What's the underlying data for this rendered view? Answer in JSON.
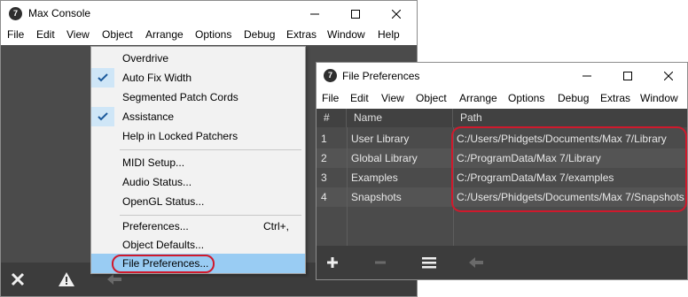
{
  "console": {
    "title": "Max Console",
    "icon_glyph": "7",
    "menu": [
      "File",
      "Edit",
      "View",
      "Object",
      "Arrange",
      "Options",
      "Debug",
      "Extras",
      "Window",
      "Help"
    ],
    "footer_icons": [
      "close-icon",
      "warning-icon",
      "back-arrow-icon"
    ]
  },
  "options_menu": {
    "items": [
      {
        "label": "Overdrive",
        "checked": false
      },
      {
        "label": "Auto Fix Width",
        "checked": true
      },
      {
        "label": "Segmented Patch Cords",
        "checked": false
      },
      {
        "label": "Assistance",
        "checked": true
      },
      {
        "label": "Help in Locked Patchers",
        "checked": false
      },
      {
        "label": "MIDI Setup...",
        "checked": false
      },
      {
        "label": "Audio Status...",
        "checked": false
      },
      {
        "label": "OpenGL Status...",
        "checked": false
      },
      {
        "label": "Preferences...",
        "shortcut": "Ctrl+,",
        "checked": false
      },
      {
        "label": "Object Defaults...",
        "checked": false
      },
      {
        "label": "File Preferences...",
        "checked": false,
        "selected": true
      }
    ]
  },
  "file_prefs": {
    "title": "File Preferences",
    "icon_glyph": "7",
    "menu": [
      "File",
      "Edit",
      "View",
      "Object",
      "Arrange",
      "Options",
      "Debug",
      "Extras",
      "Window"
    ],
    "columns": [
      "#",
      "Name",
      "Path"
    ],
    "rows": [
      {
        "num": "1",
        "name": "User Library",
        "path": "C:/Users/Phidgets/Documents/Max 7/Library"
      },
      {
        "num": "2",
        "name": "Global Library",
        "path": "C:/ProgramData/Max 7/Library"
      },
      {
        "num": "3",
        "name": "Examples",
        "path": "C:/ProgramData/Max 7/examples"
      },
      {
        "num": "4",
        "name": "Snapshots",
        "path": "C:/Users/Phidgets/Documents/Max 7/Snapshots"
      }
    ],
    "footer_icons": [
      "add-icon",
      "remove-icon",
      "list-icon",
      "back-arrow-icon"
    ]
  },
  "colors": {
    "highlight_circle": "#d0192c",
    "menu_selected": "#99ccf3",
    "panel_dark": "#4b4b4b"
  }
}
